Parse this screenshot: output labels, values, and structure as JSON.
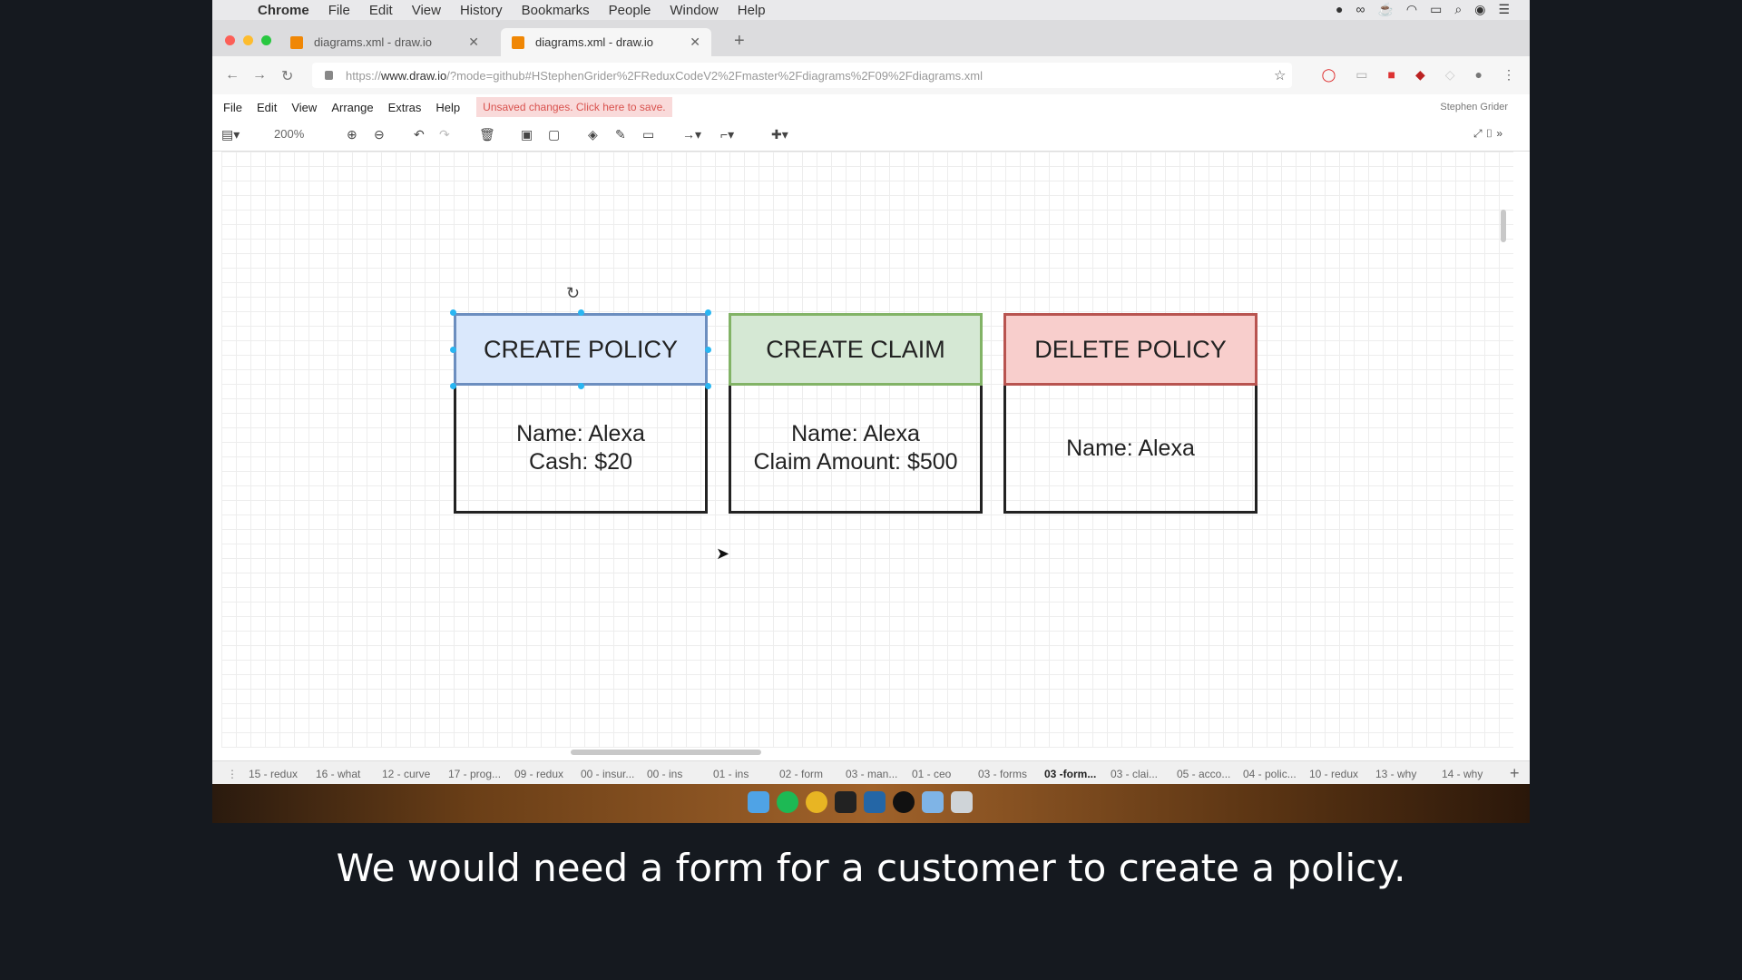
{
  "mac_menu": {
    "app": "Chrome",
    "items": [
      "File",
      "Edit",
      "View",
      "History",
      "Bookmarks",
      "People",
      "Window",
      "Help"
    ]
  },
  "tabs": [
    {
      "title": "diagrams.xml - draw.io"
    },
    {
      "title": "diagrams.xml - draw.io"
    }
  ],
  "url": {
    "prefix": "https://",
    "host": "www.draw.io",
    "rest": "/?mode=github#HStephenGrider%2FReduxCodeV2%2Fmaster%2Fdiagrams%2F09%2Fdiagrams.xml"
  },
  "drawio_menu": {
    "items": [
      "File",
      "Edit",
      "View",
      "Arrange",
      "Extras",
      "Help"
    ],
    "unsaved": "Unsaved changes. Click here to save.",
    "user": "Stephen Grider"
  },
  "toolbar": {
    "zoom": "200%"
  },
  "cards": [
    {
      "title": "CREATE POLICY",
      "lines": [
        "Name: Alexa",
        "Cash: $20"
      ],
      "color": "#dae8fc"
    },
    {
      "title": "CREATE CLAIM",
      "lines": [
        "Name: Alexa",
        "Claim Amount: $500"
      ],
      "color": "#d5e8d4"
    },
    {
      "title": "DELETE POLICY",
      "lines": [
        "Name: Alexa"
      ],
      "color": "#f8cecc"
    }
  ],
  "page_tabs": [
    "15 - redux",
    "16 - what",
    "12 - curve",
    "17 - prog...",
    "09 - redux",
    "00 - insur...",
    "00 - ins",
    "01 - ins",
    "02 - form",
    "03 - man...",
    "01 - ceo",
    "03 - forms",
    "03 -form...",
    "03 - clai...",
    "05 - acco...",
    "04 - polic...",
    "10 - redux",
    "13 - why",
    "14 - why"
  ],
  "active_page_tab": "03 -form...",
  "subtitle": "We would need a form for a customer to create a policy."
}
